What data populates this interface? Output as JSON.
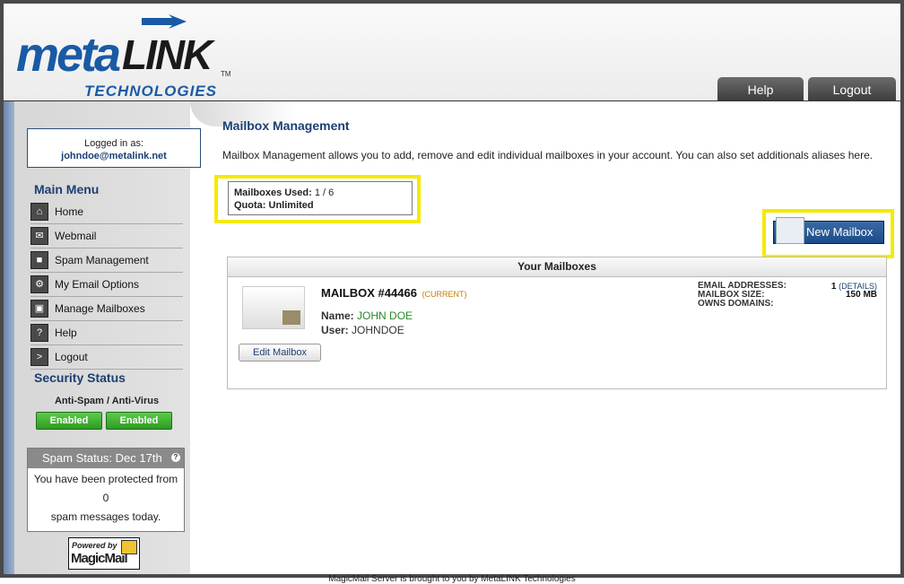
{
  "header": {
    "logo_meta": "meta",
    "logo_link": "LINK",
    "logo_tm": "TM",
    "logo_tech": "TECHNOLOGIES",
    "tabs": [
      {
        "label": "Help"
      },
      {
        "label": "Logout"
      }
    ]
  },
  "sidebar": {
    "logged_in_label": "Logged in as:",
    "user_email": "johndoe@metalink.net",
    "main_menu_title": "Main Menu",
    "menu": [
      {
        "label": "Home",
        "icon": "home-icon"
      },
      {
        "label": "Webmail",
        "icon": "envelope-icon"
      },
      {
        "label": "Spam Management",
        "icon": "lock-icon"
      },
      {
        "label": "My Email Options",
        "icon": "gears-icon"
      },
      {
        "label": "Manage Mailboxes",
        "icon": "mailbox-icon"
      },
      {
        "label": "Help",
        "icon": "question-icon"
      },
      {
        "label": "Logout",
        "icon": "logout-arrow-icon"
      }
    ],
    "security_title": "Security Status",
    "av_label": "Anti-Spam / Anti-Virus",
    "antispam_status": "Enabled",
    "antivirus_status": "Enabled",
    "spam_status_title": "Spam Status: Dec 17th",
    "spam_line1": "You have been protected from",
    "spam_count": "0",
    "spam_line2": "spam messages today.",
    "powered_by": "Powered by",
    "powered_brand": "MagicMail"
  },
  "main": {
    "title": "Mailbox Management",
    "description": "Mailbox Management allows you to add, remove and edit individual mailboxes in your account. You can also set additionals aliases here.",
    "mailboxes_used_label": "Mailboxes Used:",
    "mailboxes_used_value": "1 / 6",
    "quota_label": "Quota:",
    "quota_value": "Unlimited",
    "new_mailbox_label": "New Mailbox",
    "panel_title": "Your Mailboxes",
    "mailbox": {
      "title": "MAILBOX #44466",
      "current": "(CURRENT)",
      "name_label": "Name:",
      "name_value": "JOHN DOE",
      "user_label": "User:",
      "user_value": "JOHNDOE",
      "edit_label": "Edit Mailbox",
      "email_addresses_label": "EMAIL ADDRESSES:",
      "email_addresses_value": "1",
      "details_link": "(DETAILS)",
      "mailbox_size_label": "MAILBOX SIZE:",
      "mailbox_size_value": "150 MB",
      "owns_domains_label": "OWNS DOMAINS:"
    }
  },
  "footer": {
    "text": "MagicMail Server is brought to you by MetaLINK Technologies"
  },
  "colors": {
    "brand_blue": "#1a5aa5",
    "highlight": "#f5ea00",
    "enabled_green": "#2e9a23"
  }
}
